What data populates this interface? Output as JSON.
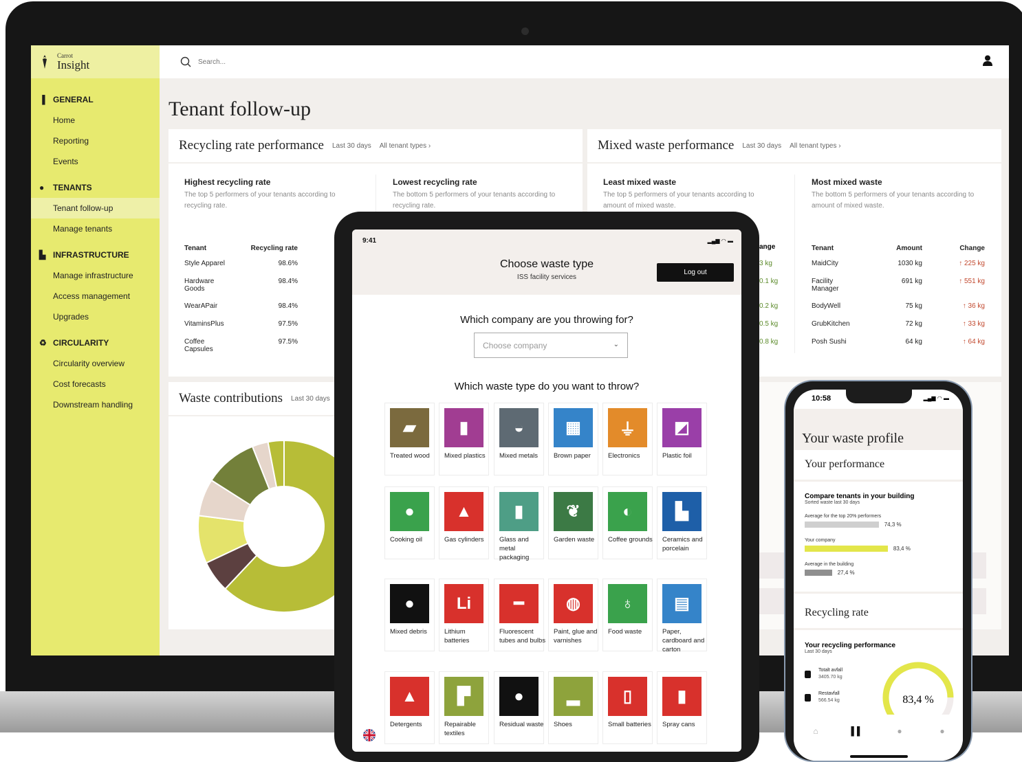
{
  "app": {
    "brand_small": "Carrot",
    "brand": "Insight",
    "search_placeholder": "Search..."
  },
  "sidebar": [
    {
      "id": "general",
      "label": "GENERAL",
      "icon": "bar-chart-icon",
      "items": [
        "Home",
        "Reporting",
        "Events"
      ]
    },
    {
      "id": "tenants",
      "label": "TENANTS",
      "icon": "people-icon",
      "items": [
        "Tenant follow-up",
        "Manage tenants"
      ]
    },
    {
      "id": "infrastructure",
      "label": "INFRASTRUCTURE",
      "icon": "building-icon",
      "items": [
        "Manage infrastructure",
        "Access management",
        "Upgrades"
      ]
    },
    {
      "id": "circularity",
      "label": "CIRCULARITY",
      "icon": "recycle-icon",
      "items": [
        "Circularity overview",
        "Cost forecasts",
        "Downstream handling"
      ]
    }
  ],
  "active_nav": "Tenant follow-up",
  "page_title": "Tenant follow-up",
  "recycling": {
    "title": "Recycling rate performance",
    "period": "Last 30 days",
    "filter": "All tenant types ›",
    "highest": {
      "title": "Highest recycling rate",
      "desc": "The top 5 performers of your tenants according to recycling rate.",
      "headers": [
        "Tenant",
        "Recycling rate"
      ],
      "rows": [
        [
          "Style Apparel",
          "98.6%"
        ],
        [
          "Hardware Goods",
          "98.4%"
        ],
        [
          "WearAPair",
          "98.4%"
        ],
        [
          "VitaminsPlus",
          "97.5%"
        ],
        [
          "Coffee Capsules",
          "97.5%"
        ]
      ]
    },
    "lowest": {
      "title": "Lowest recycling rate",
      "desc": "The bottom 5 performers of your tenants according to recycling rate."
    }
  },
  "mixed": {
    "title": "Mixed waste performance",
    "period": "Last 30 days",
    "filter": "All tenant types ›",
    "least": {
      "title": "Least mixed waste",
      "desc": "The top 5 performers of your tenants according to amount of mixed waste.",
      "header_partial": "ange",
      "changes": [
        "3 kg",
        "0.1 kg",
        "0.2 kg",
        "0.5 kg",
        "0.8 kg"
      ]
    },
    "most": {
      "title": "Most mixed waste",
      "desc": "The bottom 5 performers of your tenants according to amount of mixed waste.",
      "headers": [
        "Tenant",
        "Amount",
        "Change"
      ],
      "rows": [
        [
          "MaidCity",
          "1030 kg",
          "↑ 225 kg"
        ],
        [
          "Facility Manager",
          "691 kg",
          "↑ 551 kg"
        ],
        [
          "BodyWell",
          "75 kg",
          "↑ 36 kg"
        ],
        [
          "GrubKitchen",
          "72 kg",
          "↑ 33 kg"
        ],
        [
          "Posh Sushi",
          "64 kg",
          "↑ 64 kg"
        ]
      ]
    }
  },
  "contrib": {
    "title": "Waste contributions",
    "period": "Last 30 days",
    "chart_data": {
      "type": "pie",
      "donut": true,
      "slices": [
        {
          "value": 62,
          "color": "#b7bd37"
        },
        {
          "value": 6,
          "color": "#5c4040"
        },
        {
          "value": 9,
          "color": "#e4e36b"
        },
        {
          "value": 7,
          "color": "#e6d6cb"
        },
        {
          "value": 10,
          "color": "#73803a"
        },
        {
          "value": 3,
          "color": "#e6d6cb"
        },
        {
          "value": 3,
          "color": "#b7bd37"
        }
      ]
    }
  },
  "tablet": {
    "time": "9:41",
    "title": "Choose waste type",
    "subtitle": "ISS facility services",
    "logout": "Log out",
    "q_company": "Which company are you throwing for?",
    "company_placeholder": "Choose company",
    "q_waste": "Which waste type do you want to throw?",
    "tiles": [
      {
        "label": "Treated wood",
        "color": "#7b6a3e",
        "icon": "wood-icon",
        "glyph": "▰"
      },
      {
        "label": "Mixed plastics",
        "color": "#a13d92",
        "icon": "bottles-icon",
        "glyph": "▮"
      },
      {
        "label": "Mixed metals",
        "color": "#5e6a73",
        "icon": "pan-icon",
        "glyph": "◒"
      },
      {
        "label": "Brown paper",
        "color": "#3584c9",
        "icon": "box-icon",
        "glyph": "▦"
      },
      {
        "label": "Electronics",
        "color": "#e38b2a",
        "icon": "plug-icon",
        "glyph": "⏚"
      },
      {
        "label": "Plastic foil",
        "color": "#9a3fa8",
        "icon": "foil-roll-icon",
        "glyph": "◩"
      },
      {
        "label": "Cooking oil",
        "color": "#3aa24c",
        "icon": "drop-icon",
        "glyph": "●"
      },
      {
        "label": "Gas cylinders",
        "color": "#d8312c",
        "icon": "gas-cylinder-icon",
        "glyph": "▲"
      },
      {
        "label": "Glass and metal packaging",
        "color": "#4e9e86",
        "icon": "bottle-can-icon",
        "glyph": "▮"
      },
      {
        "label": "Garden waste",
        "color": "#3c7a45",
        "icon": "leaf-icon",
        "glyph": "❦"
      },
      {
        "label": "Coffee grounds",
        "color": "#3aa24c",
        "icon": "coffee-bean-icon",
        "glyph": "◐"
      },
      {
        "label": "Ceramics and porcelain",
        "color": "#1e5fa8",
        "icon": "toilet-icon",
        "glyph": "▙"
      },
      {
        "label": "Mixed debris",
        "color": "#111111",
        "icon": "bag-icon",
        "glyph": "●"
      },
      {
        "label": "Lithium batteries",
        "color": "#d8312c",
        "icon": "battery-li-icon",
        "glyph": "Li"
      },
      {
        "label": "Fluorescent tubes and bulbs",
        "color": "#d8312c",
        "icon": "tube-icon",
        "glyph": "━"
      },
      {
        "label": "Paint, glue and varnishes",
        "color": "#d8312c",
        "icon": "paint-bucket-icon",
        "glyph": "◍"
      },
      {
        "label": "Food waste",
        "color": "#3aa24c",
        "icon": "apple-core-icon",
        "glyph": "♁"
      },
      {
        "label": "Paper, cardboard and carton",
        "color": "#3584c9",
        "icon": "paper-stack-icon",
        "glyph": "▤"
      },
      {
        "label": "Detergents",
        "color": "#d8312c",
        "icon": "flask-icon",
        "glyph": "▲"
      },
      {
        "label": "Repairable textiles",
        "color": "#8ea33c",
        "icon": "shirt-icon",
        "glyph": "▛"
      },
      {
        "label": "Residual waste",
        "color": "#111111",
        "icon": "bag-icon",
        "glyph": "●"
      },
      {
        "label": "Shoes",
        "color": "#8ea33c",
        "icon": "shoe-icon",
        "glyph": "▂"
      },
      {
        "label": "Small batteries",
        "color": "#d8312c",
        "icon": "battery-icon",
        "glyph": "▯"
      },
      {
        "label": "Spray cans",
        "color": "#d8312c",
        "icon": "spray-can-icon",
        "glyph": "▮"
      }
    ]
  },
  "phone": {
    "time": "10:58",
    "title": "Your waste profile",
    "perf_title": "Your performance",
    "compare_title": "Compare tenants in your building",
    "compare_sub": "Sorted waste last 30 days",
    "bars": [
      {
        "label": "Average for the top 20% performers",
        "value": 74.3,
        "display": "74,3 %",
        "color": "#cfcfcf"
      },
      {
        "label": "Your company",
        "value": 83.4,
        "display": "83,4 %",
        "color": "#e3e64a"
      },
      {
        "label": "Average in the building",
        "value": 27.4,
        "display": "27,4 %",
        "color": "#8f8f8f"
      }
    ],
    "recycling_title": "Recycling rate",
    "rp_title": "Your recycling performance",
    "rp_sub": "Last 30 days",
    "stats": [
      {
        "label": "Totalt avfall",
        "value": "3405.70 kg"
      },
      {
        "label": "Restavfall",
        "value": "566.54 kg"
      }
    ],
    "gauge": {
      "value": 83.4,
      "display": "83,4 %"
    }
  }
}
